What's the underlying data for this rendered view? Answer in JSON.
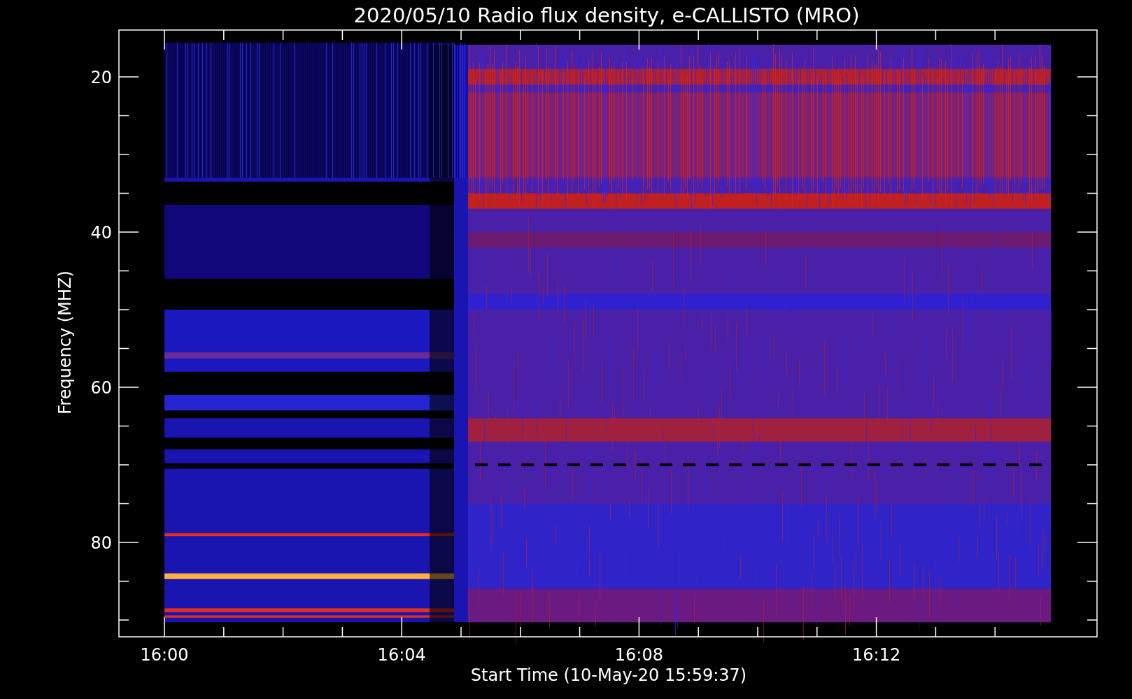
{
  "title": "2020/05/10  Radio flux density, e-CALLISTO (MRO)",
  "y_axis": {
    "label": "Frequency (MHZ)",
    "ticks": [
      "20",
      "40",
      "60",
      "80"
    ]
  },
  "x_axis": {
    "label": "Start Time (10-May-20 15:59:37)",
    "ticks": [
      "16:00",
      "16:04",
      "16:08",
      "16:12"
    ]
  }
}
